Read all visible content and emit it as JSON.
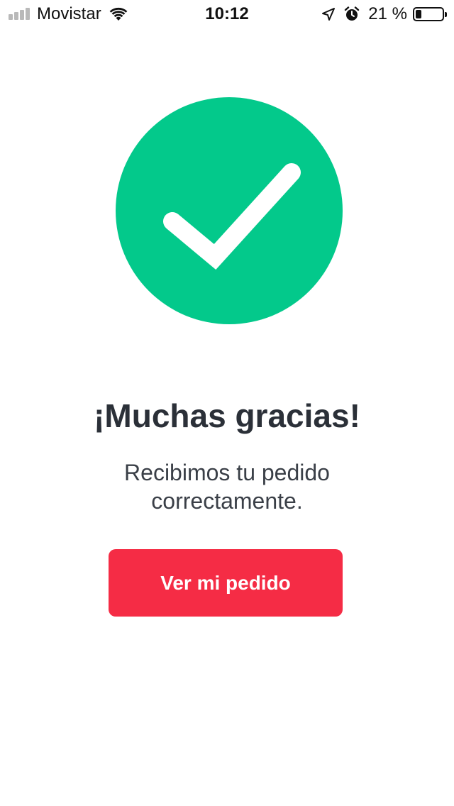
{
  "status_bar": {
    "carrier": "Movistar",
    "time": "10:12",
    "battery_percent": "21 %",
    "battery_level": 0.21,
    "signal_bars_active": 0,
    "icons": [
      "signal-icon",
      "wifi-icon",
      "location-arrow-icon",
      "alarm-icon",
      "battery-icon"
    ]
  },
  "confirmation": {
    "icon": "checkmark-circle-icon",
    "icon_color": "#03c98b",
    "title": "¡Muchas gracias!",
    "message": "Recibimos tu pedido correctamente.",
    "button_label": "Ver mi pedido",
    "button_color": "#f52c45"
  }
}
